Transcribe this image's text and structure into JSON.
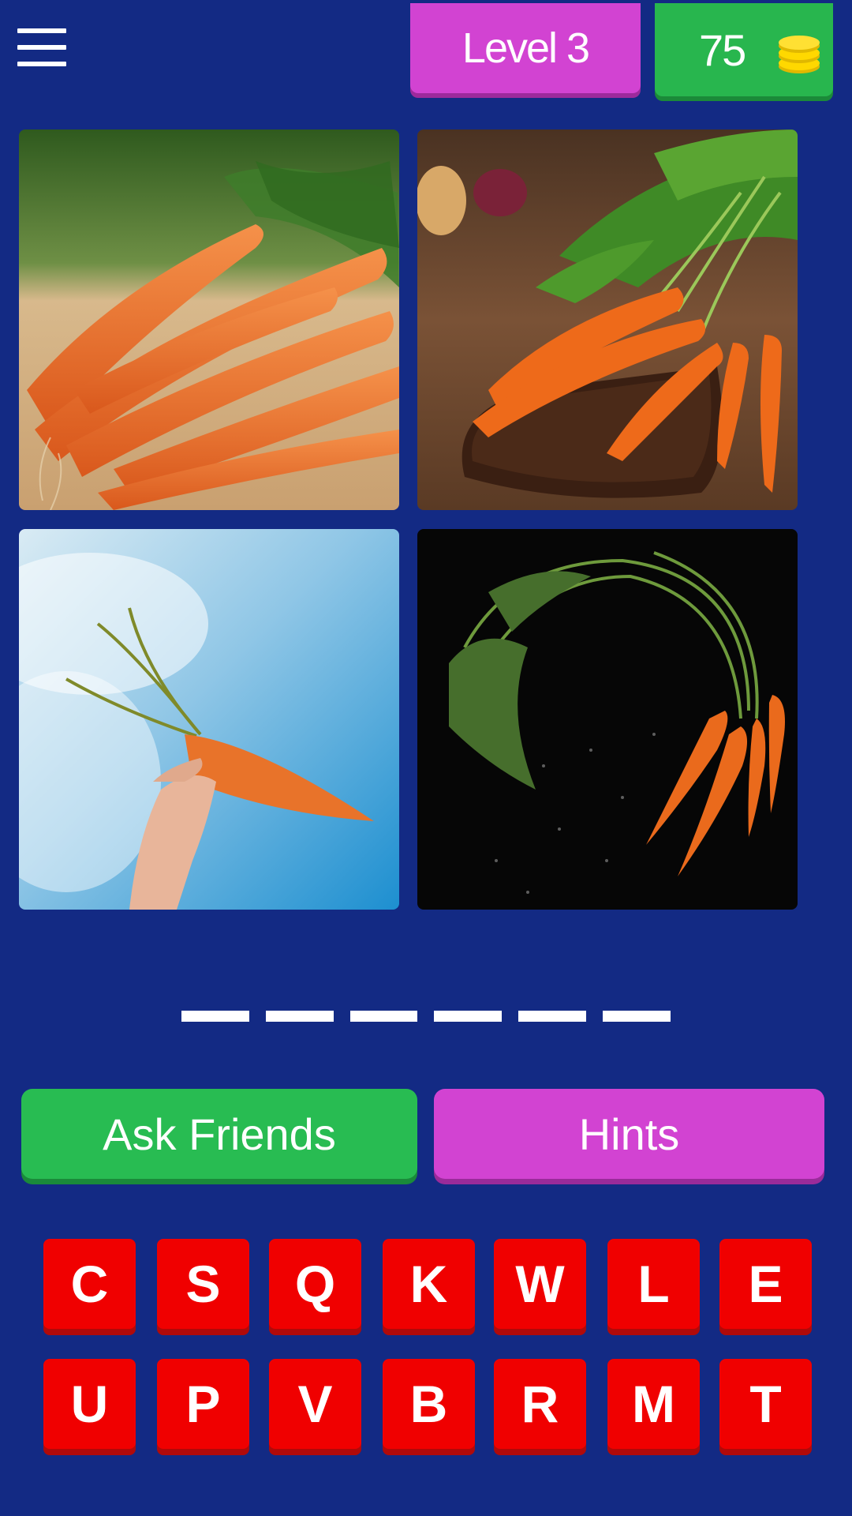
{
  "header": {
    "level_label": "Level 3",
    "coins": "75",
    "menu_icon": "hamburger-menu-icon",
    "coin_icon": "coin-stack-icon"
  },
  "images": [
    {
      "name": "carrots-on-board"
    },
    {
      "name": "carrot-bunch-on-cutting-board"
    },
    {
      "name": "hand-holding-carrot-sky"
    },
    {
      "name": "carrot-bunch-black-background"
    }
  ],
  "answer": {
    "slot_count": 6
  },
  "buttons": {
    "ask_friends": "Ask Friends",
    "hints": "Hints"
  },
  "letters": {
    "row1": [
      "C",
      "S",
      "Q",
      "K",
      "W",
      "L",
      "E"
    ],
    "row2": [
      "U",
      "P",
      "V",
      "B",
      "R",
      "M",
      "T"
    ]
  },
  "colors": {
    "background": "#132a84",
    "level_badge": "#d243d2",
    "coin_badge": "#28b64e",
    "ask_button": "#28bc52",
    "hints_button": "#d243d2",
    "letter_key": "#f00000"
  }
}
